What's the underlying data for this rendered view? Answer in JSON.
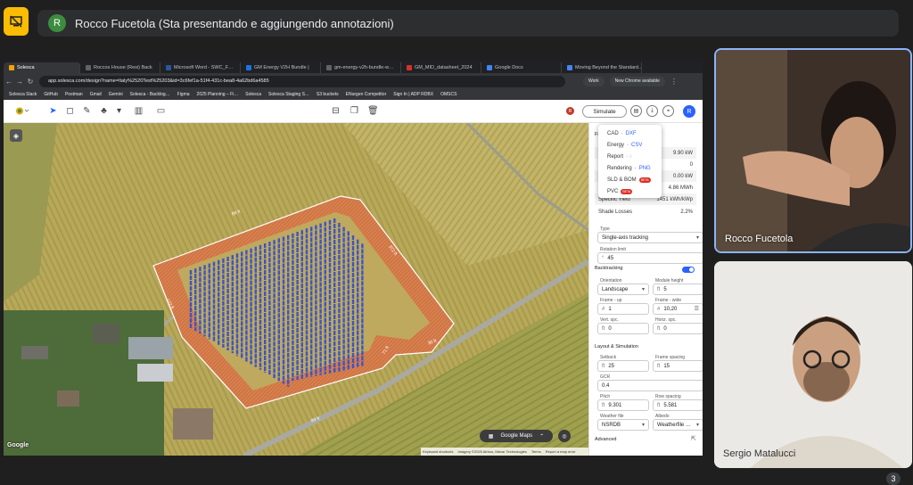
{
  "meet": {
    "presenter_initial": "R",
    "presenter_banner": "Rocco Fucetola (Sta presentando e aggiungendo annotazioni)",
    "participant_count": "3"
  },
  "participants": [
    {
      "name": "Rocco Fucetola"
    },
    {
      "name": "Sergio Matalucci"
    }
  ],
  "browser": {
    "tabs": [
      "Solesca",
      "Roccos House (Resi) Back",
      "Microsoft Word - SWC_F…",
      "GM Energy V2H Bundle |",
      "gm-energy-v2h-bundle-w…",
      "GM_MID_datasheet_2024",
      "Google Docs",
      "Moving Beyond the Standard…"
    ],
    "url": "app.solesca.com/design?name=Italy%2520Test%25203&id=3c6fef1a-51f4-431c-bea8-4a62bd6a4585",
    "work_label": "Work",
    "update_label": "New Chrome available",
    "bookmarks": [
      "Solesca Slack",
      "GitHub",
      "Postman",
      "Gmail",
      "Gemini",
      "Solesca - Backlog…",
      "Figma",
      "2025 Planning – Fi…",
      "Solesca",
      "Solesca Staging S…",
      "S3 buckets",
      "ENurgen Competitor",
      "Sign In | ADP RDBX",
      "OMSCS"
    ]
  },
  "app": {
    "simulate_label": "Simulate",
    "user_initial": "R",
    "dropdown": [
      {
        "label": "CAD",
        "format": "DXF",
        "badge": ""
      },
      {
        "label": "Energy",
        "format": "CSV",
        "badge": ""
      },
      {
        "label": "Report",
        "format": "",
        "badge": ""
      },
      {
        "label": "Rendering",
        "format": "PNG",
        "badge": ""
      },
      {
        "label": "SLD & BOM",
        "format": "",
        "badge": "BETA"
      },
      {
        "label": "PVC",
        "format": "",
        "badge": "BETA"
      }
    ],
    "stats_title": "Fi",
    "stats": [
      {
        "label": "",
        "value": "9.90 kW"
      },
      {
        "label": "",
        "value": "0"
      },
      {
        "label": "",
        "value": "0.00 kW"
      },
      {
        "label": "",
        "value": "4.86 MWh"
      },
      {
        "label": "Specific Yield",
        "value": "1451 kWh/kWp"
      },
      {
        "label": "Shade Losses",
        "value": "2.2%"
      }
    ],
    "type_label": "Type",
    "type_value": "Single-axis tracking",
    "rotation_label": "Rotation limit",
    "rotation_unit": "°",
    "rotation_value": "45",
    "backtracking_label": "Backtracking",
    "orientation_label": "Orientation",
    "orientation_value": "Landscape",
    "module_height_label": "Module height",
    "module_height_unit": "ft",
    "module_height_value": "5",
    "frame_up_label": "Frame - up",
    "frame_up_unit": "#",
    "frame_up_value": "1",
    "frame_wide_label": "Frame - wide",
    "frame_wide_unit": "#",
    "frame_wide_value": "10,20",
    "vert_spc_label": "Vert. spc.",
    "vert_spc_unit": "ft",
    "vert_spc_value": "0",
    "horiz_spc_label": "Horiz. spc.",
    "horiz_spc_unit": "ft",
    "horiz_spc_value": "0",
    "layout_title": "Layout & Simulation",
    "setback_label": "Setback",
    "setback_unit": "ft",
    "setback_value": "25",
    "frame_spacing_label": "Frame spacing",
    "frame_spacing_unit": "ft",
    "frame_spacing_value": "15",
    "gcr_label": "GCR",
    "gcr_value": "0.4",
    "pitch_label": "Pitch",
    "pitch_unit": "ft",
    "pitch_value": "9.301",
    "row_spacing_label": "Row spacing",
    "row_spacing_unit": "ft",
    "row_spacing_value": "5.581",
    "weather_label": "Weather file",
    "weather_value": "NSRDB",
    "albedo_label": "Albedo",
    "albedo_value": "Weatherfile …",
    "advanced_label": "Advanced"
  },
  "map": {
    "google_maps_label": "Google Maps",
    "google_logo": "Google",
    "attribution": [
      "Keyboard shortcuts",
      "Imagery ©2025 Airbus, Maxar Technologies",
      "Terms",
      "Report a map error"
    ],
    "dims": [
      "88 ft",
      "372 ft",
      "12 ft",
      "71 ft",
      "172 ft",
      "30 ft",
      "46 ft",
      "89 ft"
    ]
  }
}
